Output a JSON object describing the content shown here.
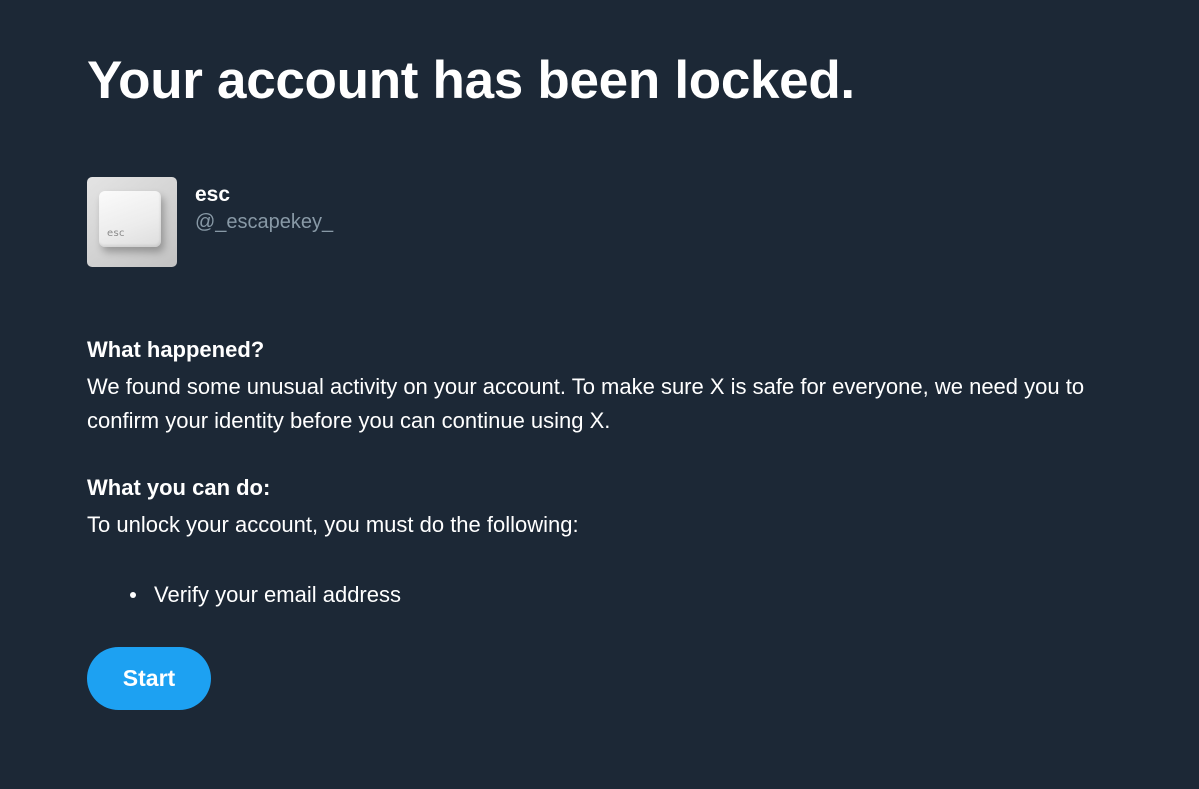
{
  "page": {
    "title": "Your account has been locked."
  },
  "profile": {
    "display_name": "esc",
    "handle": "@_escapekey_",
    "avatar_key_label": "esc"
  },
  "sections": [
    {
      "heading": "What happened?",
      "body": "We found some unusual activity on your account. To make sure X is safe for everyone, we need you to confirm your identity before you can continue using X."
    },
    {
      "heading": "What you can do:",
      "body": "To unlock your account, you must do the following:"
    }
  ],
  "requirements": [
    "Verify your email address"
  ],
  "actions": {
    "start_label": "Start"
  },
  "colors": {
    "background": "#1c2836",
    "text": "#ffffff",
    "muted": "#8899a6",
    "accent": "#1da1f2"
  },
  "icons": {
    "bullet": "bullet-icon",
    "avatar": "esc-keycap"
  }
}
